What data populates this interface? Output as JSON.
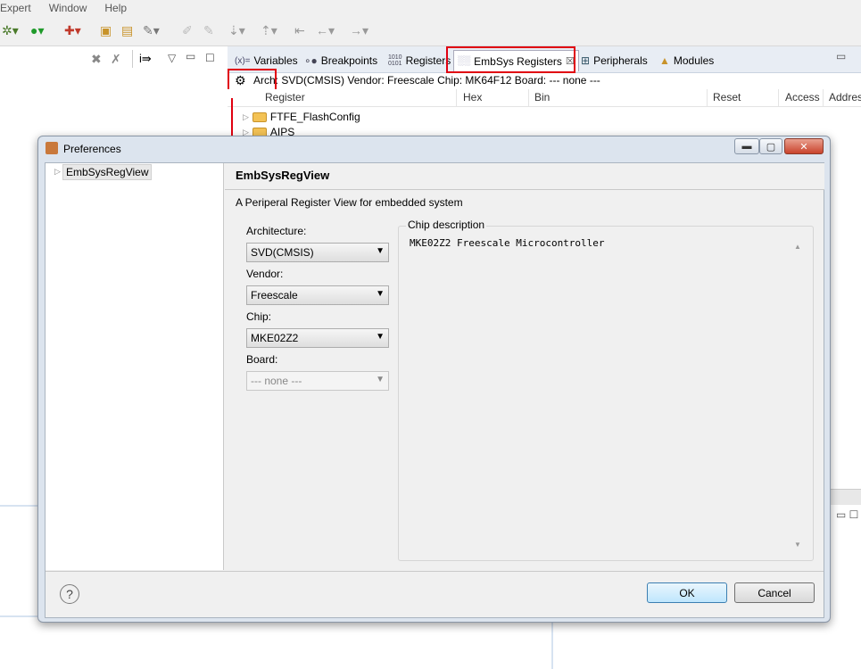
{
  "menu": [
    "Expert",
    "Window",
    "Help"
  ],
  "view_tabs": [
    {
      "label": "Variables",
      "icon": "(x)="
    },
    {
      "label": "Breakpoints",
      "icon": "breakpoints-icon"
    },
    {
      "label": "Registers",
      "icon": "registers-icon"
    },
    {
      "label": "EmbSys Registers",
      "icon": "embsys-icon",
      "active": true
    },
    {
      "label": "Peripherals",
      "icon": "peripherals-icon"
    },
    {
      "label": "Modules",
      "icon": "modules-icon"
    }
  ],
  "variables_icon_text": "(x)=",
  "registers_icon_text": "1010\n0101",
  "info_bar": "Arch: SVD(CMSIS)  Vendor: Freescale  Chip: MK64F12  Board: ---  none ---",
  "table_headers": [
    "Register",
    "Hex",
    "Bin",
    "Reset",
    "Access",
    "Address"
  ],
  "tree_rows": [
    "FTFE_FlashConfig",
    "AIPS"
  ],
  "dialog": {
    "title": "Preferences",
    "nav_item": "EmbSysRegView",
    "page_title": "EmbSysRegView",
    "description": "A Periperal Register View for embedded system",
    "arch_label": "Architecture:",
    "arch_value": "SVD(CMSIS)",
    "vendor_label": "Vendor:",
    "vendor_value": "Freescale",
    "chip_label": "Chip:",
    "chip_value": "MK E02Z2",
    "board_label": "Board:",
    "board_value": "---  none ---",
    "chip_desc_label": "Chip description",
    "chip_desc_text": "MKE02Z2 Freescale Microcontroller",
    "ok_label": "OK",
    "cancel_label": "Cancel",
    "help_icon": "?"
  }
}
